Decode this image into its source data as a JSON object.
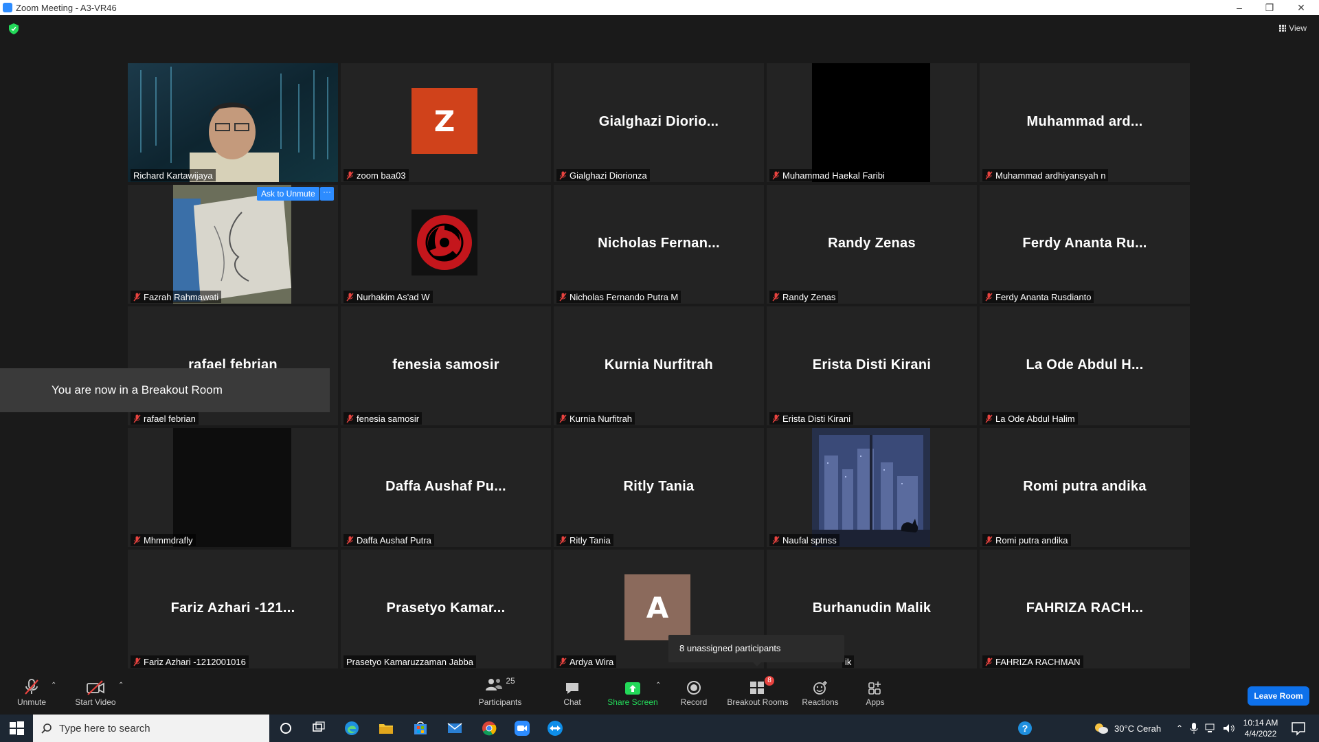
{
  "window": {
    "title": "Zoom Meeting - A3-VR46"
  },
  "header": {
    "view_label": "View"
  },
  "tiles": [
    {
      "label": "Richard Kartawijaya"
    },
    {
      "label": "zoom baa03",
      "avatar": "Z",
      "avatar_color": "#d0421b"
    },
    {
      "label": "Gialghazi Diorionza",
      "display": "Gialghazi  Diorio..."
    },
    {
      "label": "Muhammad Haekal Faribi"
    },
    {
      "label": "Muhammad ardhiyansyah n",
      "display": "Muhammad  ard..."
    },
    {
      "label": "Fazrah Rahmawati"
    },
    {
      "label": "Nurhakim As'ad W"
    },
    {
      "label": "Nicholas Fernando Putra M",
      "display": "Nicholas  Fernan..."
    },
    {
      "label": "Randy Zenas",
      "display": "Randy Zenas"
    },
    {
      "label": "Ferdy Ananta Rusdianto",
      "display": "Ferdy  Ananta  Ru..."
    },
    {
      "label": "rafael febrian",
      "display": "rafael febrian"
    },
    {
      "label": "fenesia samosir",
      "display": "fenesia samosir"
    },
    {
      "label": "Kurnia Nurfitrah",
      "display": "Kurnia Nurfitrah"
    },
    {
      "label": "Erista Disti Kirani",
      "display": "Erista Disti Kirani"
    },
    {
      "label": "La Ode Abdul Halim",
      "display": "La Ode Abdul H..."
    },
    {
      "label": "Mhmmdrafly"
    },
    {
      "label": "Daffa Aushaf Putra",
      "display": "Daffa  Aushaf  Pu..."
    },
    {
      "label": "Ritly Tania",
      "display": "Ritly Tania"
    },
    {
      "label": "Naufal sptnss"
    },
    {
      "label": "Romi putra andika",
      "display": "Romi putra andika"
    },
    {
      "label": "Fariz Azhari -1212001016",
      "display": "Fariz Azhari -121..."
    },
    {
      "label": "Prasetyo Kamaruzzaman Jabba",
      "display": "Prasetyo  Kamar..."
    },
    {
      "label": "Ardya Wira",
      "avatar": "A",
      "avatar_color": "#8b6a5c"
    },
    {
      "label": "ik",
      "display": "Burhanudin Malik"
    },
    {
      "label": "FAHRIZA RACHMAN",
      "display": "FAHRIZA  RACH..."
    }
  ],
  "overlays": {
    "ask_to_unmute": "Ask to Unmute",
    "more": "···",
    "breakout_toast": "You are now in a Breakout Room",
    "unassigned": "8 unassigned participants"
  },
  "toolbar": {
    "unmute": "Unmute",
    "start_video": "Start Video",
    "participants": "Participants",
    "participants_count": "25",
    "chat": "Chat",
    "share_screen": "Share Screen",
    "record": "Record",
    "breakout_rooms": "Breakout Rooms",
    "breakout_badge": "8",
    "reactions": "Reactions",
    "apps": "Apps",
    "leave_room": "Leave Room"
  },
  "taskbar": {
    "search_placeholder": "Type here to search",
    "weather": "30°C  Cerah",
    "time": "10:14 AM",
    "date": "4/4/2022"
  },
  "colors": {
    "active_speaker": "#e9e33f",
    "accent": "#2d8cff",
    "share_green": "#23d959"
  }
}
